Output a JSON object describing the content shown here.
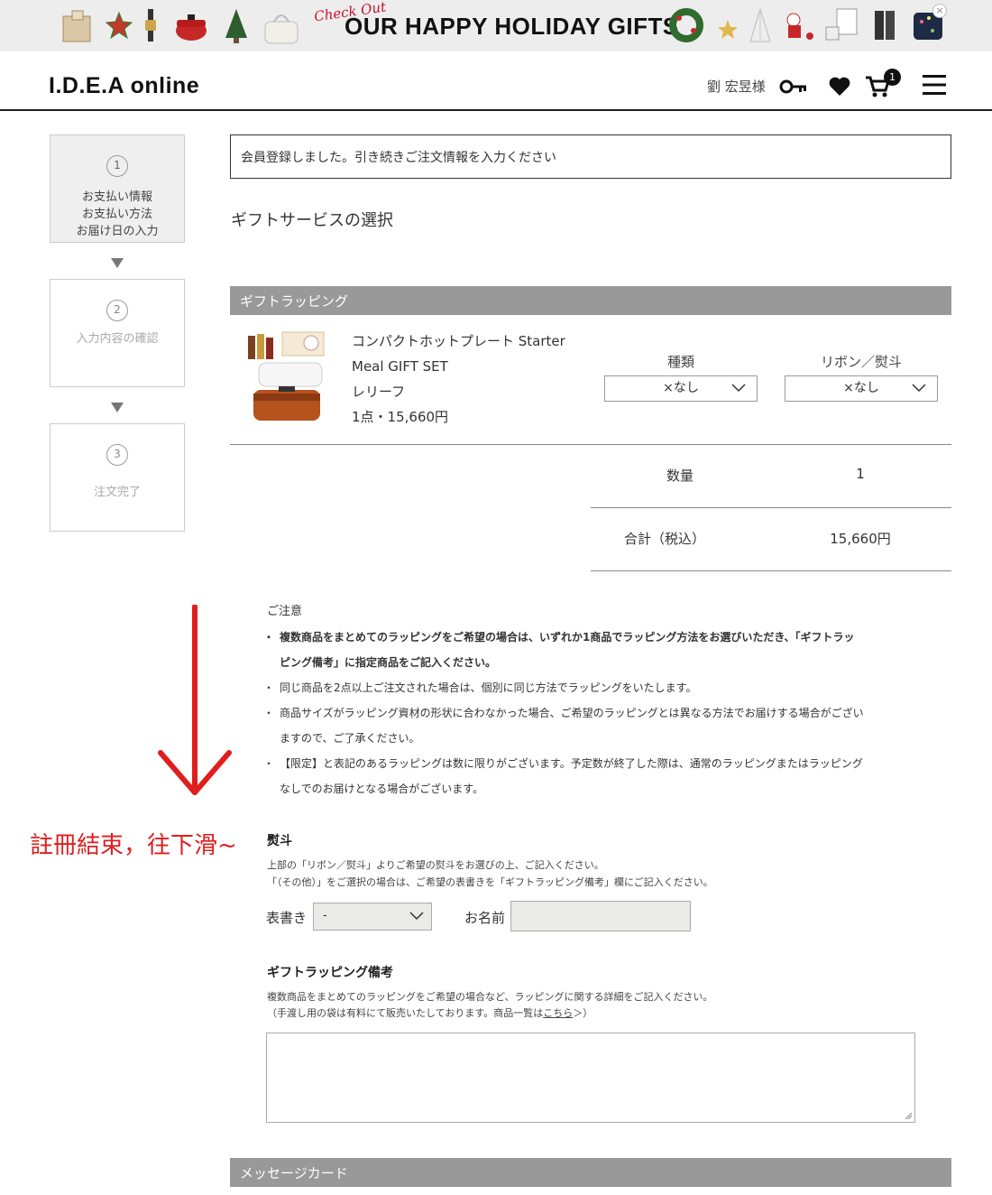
{
  "banner": {
    "checkout_text": "Check Out",
    "title": "OUR HAPPY HOLIDAY GIFTS",
    "close_label": "×"
  },
  "header": {
    "logo": "I.D.E.A online",
    "user_name": "劉 宏昱様",
    "cart_count": "1"
  },
  "steps": [
    {
      "num": "1",
      "lines": [
        "お支払い情報",
        "お支払い方法",
        "お届け日の入力"
      ]
    },
    {
      "num": "2",
      "lines": [
        "入力内容の確認"
      ]
    },
    {
      "num": "3",
      "lines": [
        "注文完了"
      ]
    }
  ],
  "notice": "会員登録しました。引き続きご注文情報を入力ください",
  "section_heading": "ギフトサービスの選択",
  "gift_wrapping": {
    "bar_label": "ギフトラッピング",
    "product": {
      "name_line1": "コンパクトホットプレート Starter",
      "name_line2": "Meal GIFT SET",
      "variant": "レリーフ",
      "qty_price": "1点・15,660円"
    },
    "type_label": "種類",
    "type_value": "×なし",
    "ribbon_label": "リボン／熨斗",
    "ribbon_value": "×なし",
    "quantity_label": "数量",
    "quantity_value": "1",
    "total_label": "合計（税込）",
    "total_value": "15,660円"
  },
  "caution": {
    "title": "ご注意",
    "item1_line1": "複数商品をまとめてのラッピングをご希望の場合は、いずれか1商品でラッピング方法をお選びいただき、「ギフトラッ",
    "item1_line2": "ピング備考」に指定商品をご記入ください。",
    "item2": "同じ商品を2点以上ご注文された場合は、個別に同じ方法でラッピングをいたします。",
    "item3_line1": "商品サイズがラッピング資材の形状に合わなかった場合、ご希望のラッピングとは異なる方法でお届けする場合がござい",
    "item3_line2": "ますので、ご了承ください。",
    "item4_line1": "【限定】と表記のあるラッピングは数に限りがございます。予定数が終了した際は、通常のラッピングまたはラッピング",
    "item4_line2": "なしでのお届けとなる場合がございます。"
  },
  "annotation": "註冊結束，往下滑~",
  "noshi": {
    "title": "熨斗",
    "desc1": "上部の「リボン／熨斗」よりご希望の熨斗をお選びの上、ご記入ください。",
    "desc2": "「（その他）」をご選択の場合は、ご希望の表書きを「ギフトラッピング備考」欄にご記入ください。",
    "omotegaki_label": "表書き",
    "omotegaki_value": "-",
    "name_label": "お名前",
    "name_value": ""
  },
  "remarks": {
    "title": "ギフトラッピング備考",
    "desc1": "複数商品をまとめてのラッピングをご希望の場合など、ラッピングに関する詳細をご記入ください。",
    "desc2_prefix": "（手渡し用の袋は有料にて販売いたしております。商品一覧は",
    "desc2_link": "こちら",
    "desc2_suffix": "＞）",
    "value": ""
  },
  "message_card": {
    "bar_label": "メッセージカード"
  },
  "colors": {
    "accent_red": "#e01e1e",
    "bar_grey": "#999999",
    "banner_bg": "#ededed"
  }
}
